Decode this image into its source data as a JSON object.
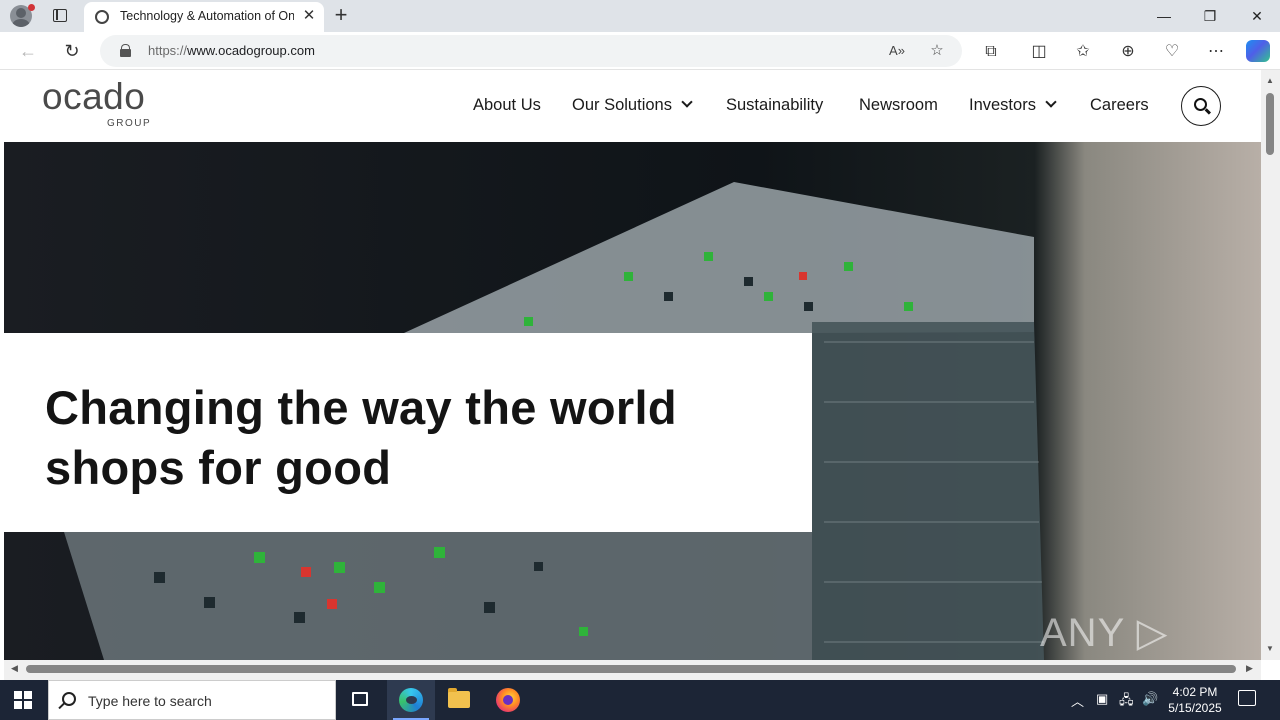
{
  "browser": {
    "tab_title": "Technology & Automation of Online Grocery | Ocado Group",
    "url_prefix": "https://",
    "url_host": "www.ocadogroup.com",
    "new_tab_symbol": "+",
    "close_tab_symbol": "✕"
  },
  "window_controls": {
    "minimize": "—",
    "restore": "❐",
    "close": "✕"
  },
  "site": {
    "logo_word": "ocado",
    "logo_sub": "GROUP",
    "nav": [
      {
        "label": "About Us",
        "has_dropdown": false
      },
      {
        "label": "Our Solutions",
        "has_dropdown": true
      },
      {
        "label": "Sustainability",
        "has_dropdown": false
      },
      {
        "label": "Newsroom",
        "has_dropdown": false
      },
      {
        "label": "Investors",
        "has_dropdown": true
      },
      {
        "label": "Careers",
        "has_dropdown": false
      }
    ],
    "hero_title": "Changing the way the world shops for good",
    "watermark": "ANY ▷ RUN"
  },
  "taskbar": {
    "search_placeholder": "Type here to search",
    "time": "4:02 PM",
    "date": "5/15/2025"
  },
  "colors": {
    "tab_strip": "#dfe3e8",
    "taskbar": "#1c2536",
    "text_dark": "#1b1b1b"
  }
}
